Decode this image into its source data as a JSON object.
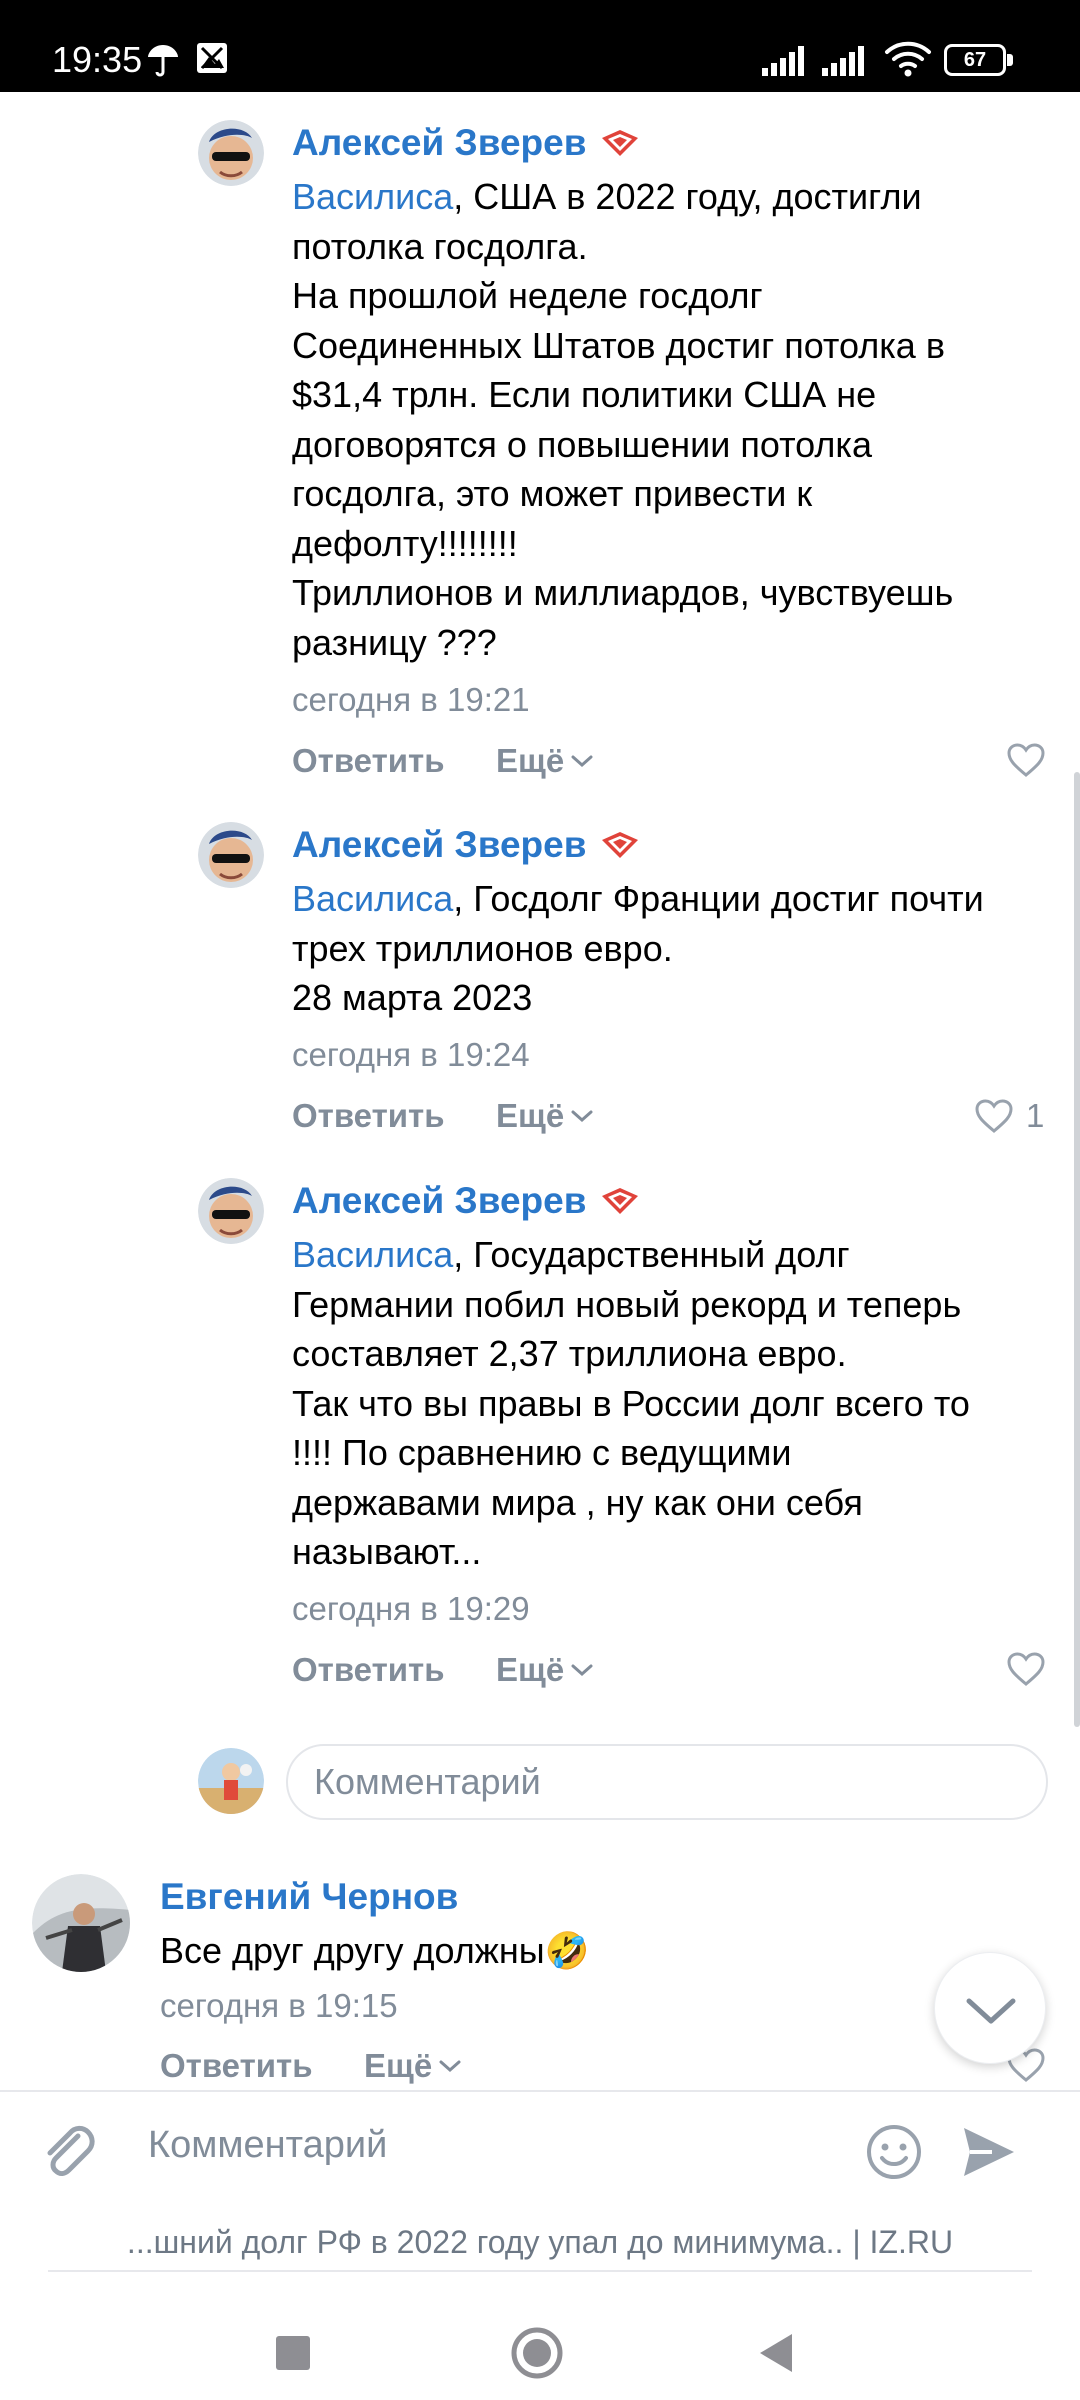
{
  "status_bar": {
    "time": "19:35",
    "battery": "67",
    "icons": [
      "umbrella-icon",
      "image-notification-icon",
      "signal-icon",
      "signal-icon",
      "wifi-icon",
      "battery-icon"
    ]
  },
  "comments": [
    {
      "author": "Алексей Зверев",
      "mention": "Василиса",
      "text": ", США в 2022 году, достигли\nпотолка госдолга.\nНа прошлой неделе госдолг\nСоединенных Штатов достиг потолка в\n$31,4 трлн. Если политики США не\nдоговорятся о повышении потолка\nгосдолга, это может привести к\nдефолту!!!!!!!!\nТриллионов и миллиардов, чувствуешь\nразницу ???",
      "time": "сегодня в 19:21",
      "reply": "Ответить",
      "more": "Ещё",
      "likes": ""
    },
    {
      "author": "Алексей Зверев",
      "mention": "Василиса",
      "text": ", Госдолг Франции достиг почти\nтрех триллионов евро.\n28 марта 2023",
      "time": "сегодня в 19:24",
      "reply": "Ответить",
      "more": "Ещё",
      "likes": "1"
    },
    {
      "author": "Алексей Зверев",
      "mention": "Василиса",
      "text": ", Государственный долг\nГермании побил новый рекорд и теперь\nсоставляет 2,37 триллиона евро.\nТак что вы правы в России долг всего то\n!!!! По сравнению с ведущими\nдержавами мира , ну как они себя\nназывают...",
      "time": "сегодня в 19:29",
      "reply": "Ответить",
      "more": "Ещё",
      "likes": ""
    }
  ],
  "reply_input": {
    "placeholder": "Комментарий"
  },
  "top_comment": {
    "author": "Евгений Чернов",
    "text": "Все друг другу должны",
    "emoji": "🤣",
    "time": "сегодня в 19:15",
    "reply": "Ответить",
    "more": "Ещё"
  },
  "bottom_bar": {
    "placeholder": "Комментарий",
    "source": "...шний долг РФ в 2022 году упал до минимума.. | IZ.RU"
  },
  "colors": {
    "accent": "#2a77c9",
    "secondary": "#818c99",
    "badge": "#e0433a"
  }
}
